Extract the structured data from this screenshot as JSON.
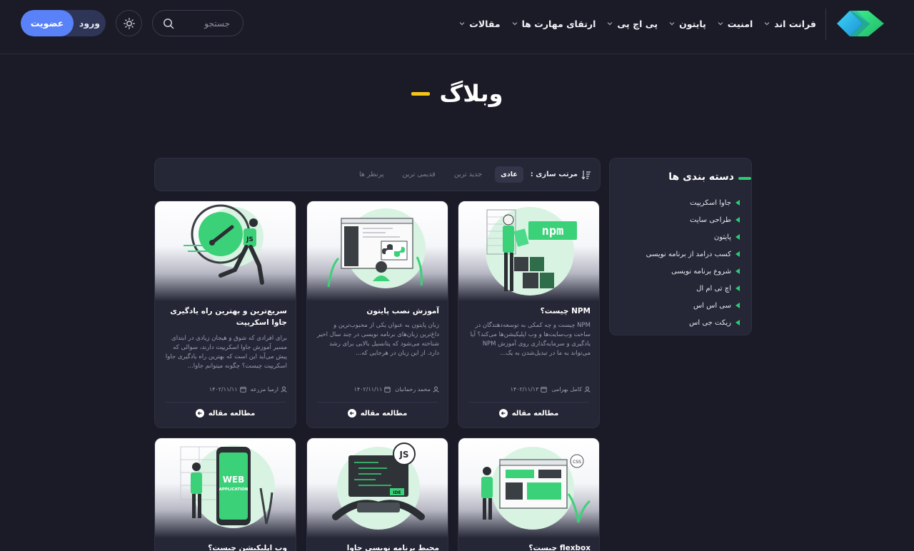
{
  "header": {
    "nav": [
      {
        "label": "فرانت اند"
      },
      {
        "label": "امنیت"
      },
      {
        "label": "پایتون"
      },
      {
        "label": "پی اچ پی"
      },
      {
        "label": "ارتقای مهارت ها"
      },
      {
        "label": "مقالات"
      }
    ],
    "search_placeholder": "جستجو",
    "login_label": "ورود",
    "signup_label": "عضویت"
  },
  "page": {
    "title": "وبلاگ"
  },
  "sort": {
    "label": "مرتب سازی :",
    "options": [
      {
        "label": "عادی",
        "active": true
      },
      {
        "label": "جدید ترین",
        "active": false
      },
      {
        "label": "قدیمی ترین",
        "active": false
      },
      {
        "label": "پرنظر ها",
        "active": false
      }
    ]
  },
  "sidebar": {
    "title": "دسته بندی ها",
    "categories": [
      "جاوا اسکریپت",
      "طراحی سایت",
      "پایتون",
      "کسب درامد از برنامه نویسی",
      "شروع برنامه نویسی",
      "اچ تی ام ال",
      "سی اس اس",
      "ریکت جی اس"
    ]
  },
  "posts": [
    {
      "title": "NPM چیست؟",
      "excerpt": "NPM چیست و چه کمکی به توسعه‌دهندگان در ساخت وب‌سایت‌ها و وب اپلیکیشن‌ها می‌کند؟ آیا یادگیری و سرمایه‌گذاری روی آموزش NPM می‌تواند به ما در تبدیل‌شدن به یک...",
      "author": "کامل بهرامی",
      "date": "۱۴۰۲/۱۱/۱۳",
      "read_label": "مطالعه مقاله",
      "image": "npm-illustration"
    },
    {
      "title": "آموزش نصب پایتون",
      "excerpt": "زبان پایتون به عنوان یکی از محبوب‌ترین و داغ‌ترین زبان‌های برنامه نویسی در چند سال اخیر شناخته می‌شود که پتانسیل بالایی برای رشد دارد. از این زبان در هرجایی که...",
      "author": "محمد رحمانیان",
      "date": "۱۴۰۲/۱۱/۱۱",
      "read_label": "مطالعه مقاله",
      "image": "python-illustration"
    },
    {
      "title": "سریع‌ترین و بهترین راه یادگیری جاوا اسکریپت",
      "excerpt": "برای افرادی که شوق و هیجان زیادی در ابتدای مسیر آموزش جاوا اسکریپت دارند، سوالی که پیش می‌آید این است که بهترین راه یادگیری جاوا اسکریپت چیست؟ چگونه میتوانم جاوا...",
      "author": "ارمیا مزرعه",
      "date": "۱۴۰۲/۱۱/۱۱",
      "read_label": "مطالعه مقاله",
      "image": "javascript-runner-illustration"
    },
    {
      "title": "flexbox چیست؟",
      "image": "flexbox-illustration"
    },
    {
      "title": "محیط برنامه نویسی جاوا اسکریپت",
      "image": "js-ide-illustration"
    },
    {
      "title": "وب اپلیکیشن چیست؟",
      "image": "web-app-illustration"
    }
  ]
}
